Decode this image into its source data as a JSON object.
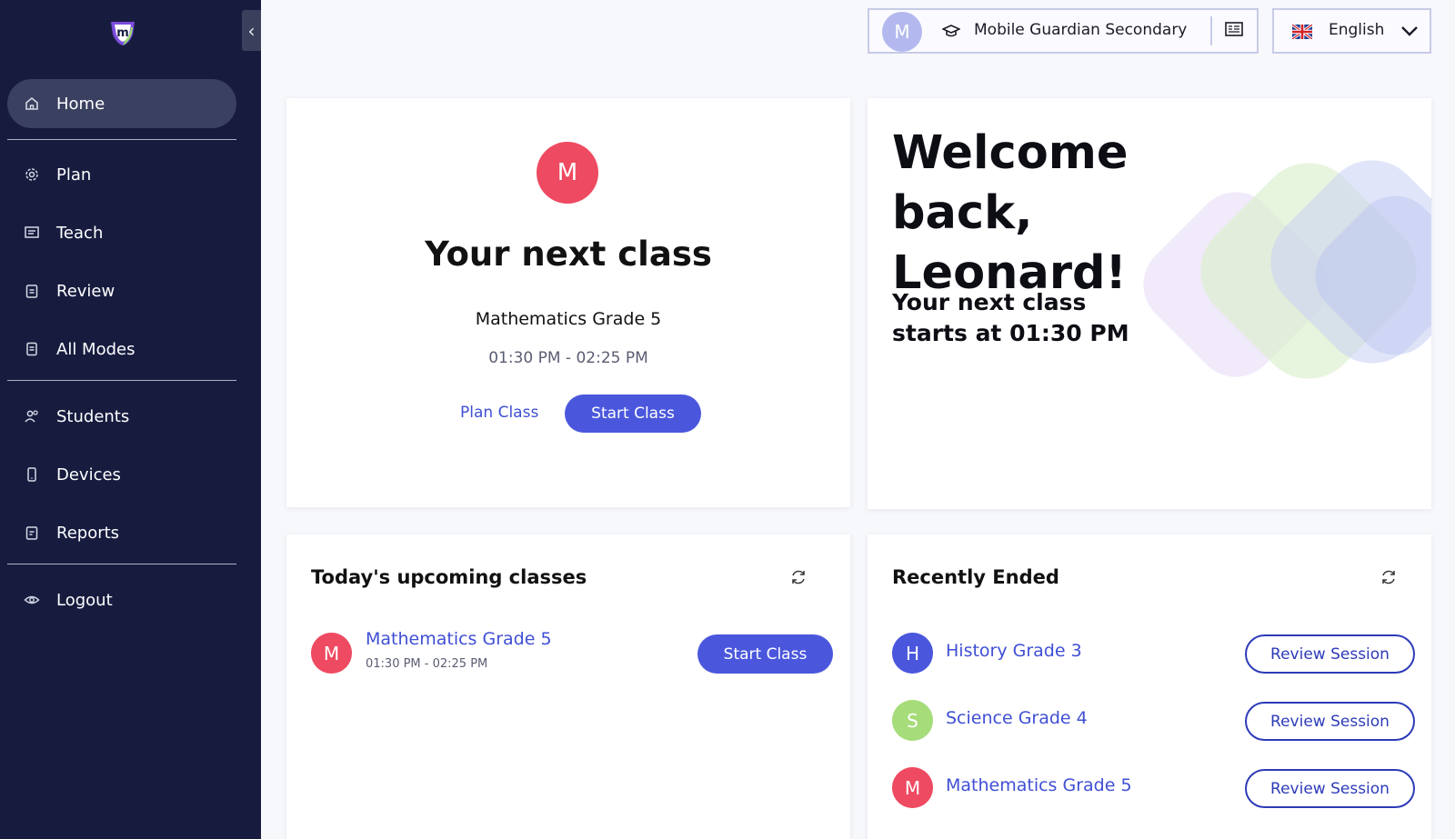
{
  "sidebar": {
    "collapse_glyph": "‹",
    "items": [
      {
        "label": "Home",
        "icon": "home-icon",
        "active": true
      },
      {
        "label": "Plan",
        "icon": "gear-icon"
      },
      {
        "label": "Teach",
        "icon": "teach-board-icon"
      },
      {
        "label": "Review",
        "icon": "clipboard-icon"
      },
      {
        "label": "All Modes",
        "icon": "document-icon"
      },
      {
        "label": "Students",
        "icon": "users-icon"
      },
      {
        "label": "Devices",
        "icon": "phone-icon"
      },
      {
        "label": "Reports",
        "icon": "report-icon"
      },
      {
        "label": "Logout",
        "icon": "eye-icon"
      }
    ]
  },
  "topbar": {
    "user_initial": "M",
    "school_name": "Mobile Guardian Secondary",
    "language": "English"
  },
  "next_class": {
    "initial": "M",
    "title": "Your next class",
    "course": "Mathematics Grade 5",
    "time": "01:30 PM - 02:25 PM",
    "plan_label": "Plan Class",
    "start_label": "Start Class"
  },
  "welcome": {
    "title": "Welcome back, Leonard!",
    "subtitle": "Your next class starts at 01:30 PM"
  },
  "upcoming": {
    "title": "Today's upcoming classes",
    "items": [
      {
        "initial": "M",
        "name": "Mathematics Grade 5",
        "time": "01:30 PM - 02:25 PM",
        "action": "Start Class",
        "color": "#ee4a61"
      }
    ]
  },
  "recent": {
    "title": "Recently Ended",
    "items": [
      {
        "initial": "H",
        "name": "History Grade 3",
        "action": "Review Session",
        "color": "#4a57dd"
      },
      {
        "initial": "S",
        "name": "Science Grade 4",
        "action": "Review Session",
        "color": "#a6dc7a"
      },
      {
        "initial": "M",
        "name": "Mathematics Grade 5",
        "action": "Review Session",
        "color": "#ee4a61"
      }
    ]
  },
  "colors": {
    "sidebar_bg": "#171c3f",
    "primary": "#4a57dd",
    "link": "#3f4fd4",
    "accent_red": "#ee4a61"
  }
}
